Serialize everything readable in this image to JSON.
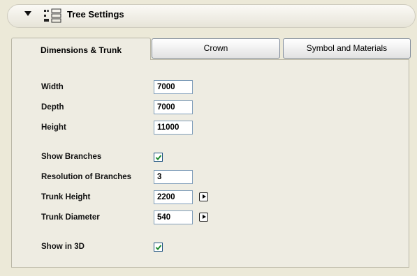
{
  "header": {
    "title": "Tree Settings",
    "collapse_icon": "triangle-down-icon",
    "settings_icon": "settings-list-icon"
  },
  "tabs": [
    {
      "label": "Dimensions & Trunk",
      "active": true
    },
    {
      "label": "Crown",
      "active": false
    },
    {
      "label": "Symbol and Materials",
      "active": false
    }
  ],
  "form": {
    "width": {
      "label": "Width",
      "value": "7000"
    },
    "depth": {
      "label": "Depth",
      "value": "7000"
    },
    "height": {
      "label": "Height",
      "value": "11000"
    },
    "show_branches": {
      "label": "Show Branches",
      "checked": true
    },
    "resolution_of_branches": {
      "label": "Resolution of Branches",
      "value": "3"
    },
    "trunk_height": {
      "label": "Trunk Height",
      "value": "2200"
    },
    "trunk_diameter": {
      "label": "Trunk Diameter",
      "value": "540"
    },
    "show_in_3d": {
      "label": "Show in 3D",
      "checked": true
    }
  },
  "preview": {
    "icon": "tree-preview-icon",
    "colors": {
      "leaf_dark": "#2e6b22",
      "leaf_light": "#5fa64a",
      "trunk": "#6b4a2e",
      "ground": "#111111"
    }
  },
  "colors": {
    "background": "#ece9d8",
    "panel": "#eeece2",
    "field_border": "#7f9db9",
    "check": "#1c8a2e"
  }
}
